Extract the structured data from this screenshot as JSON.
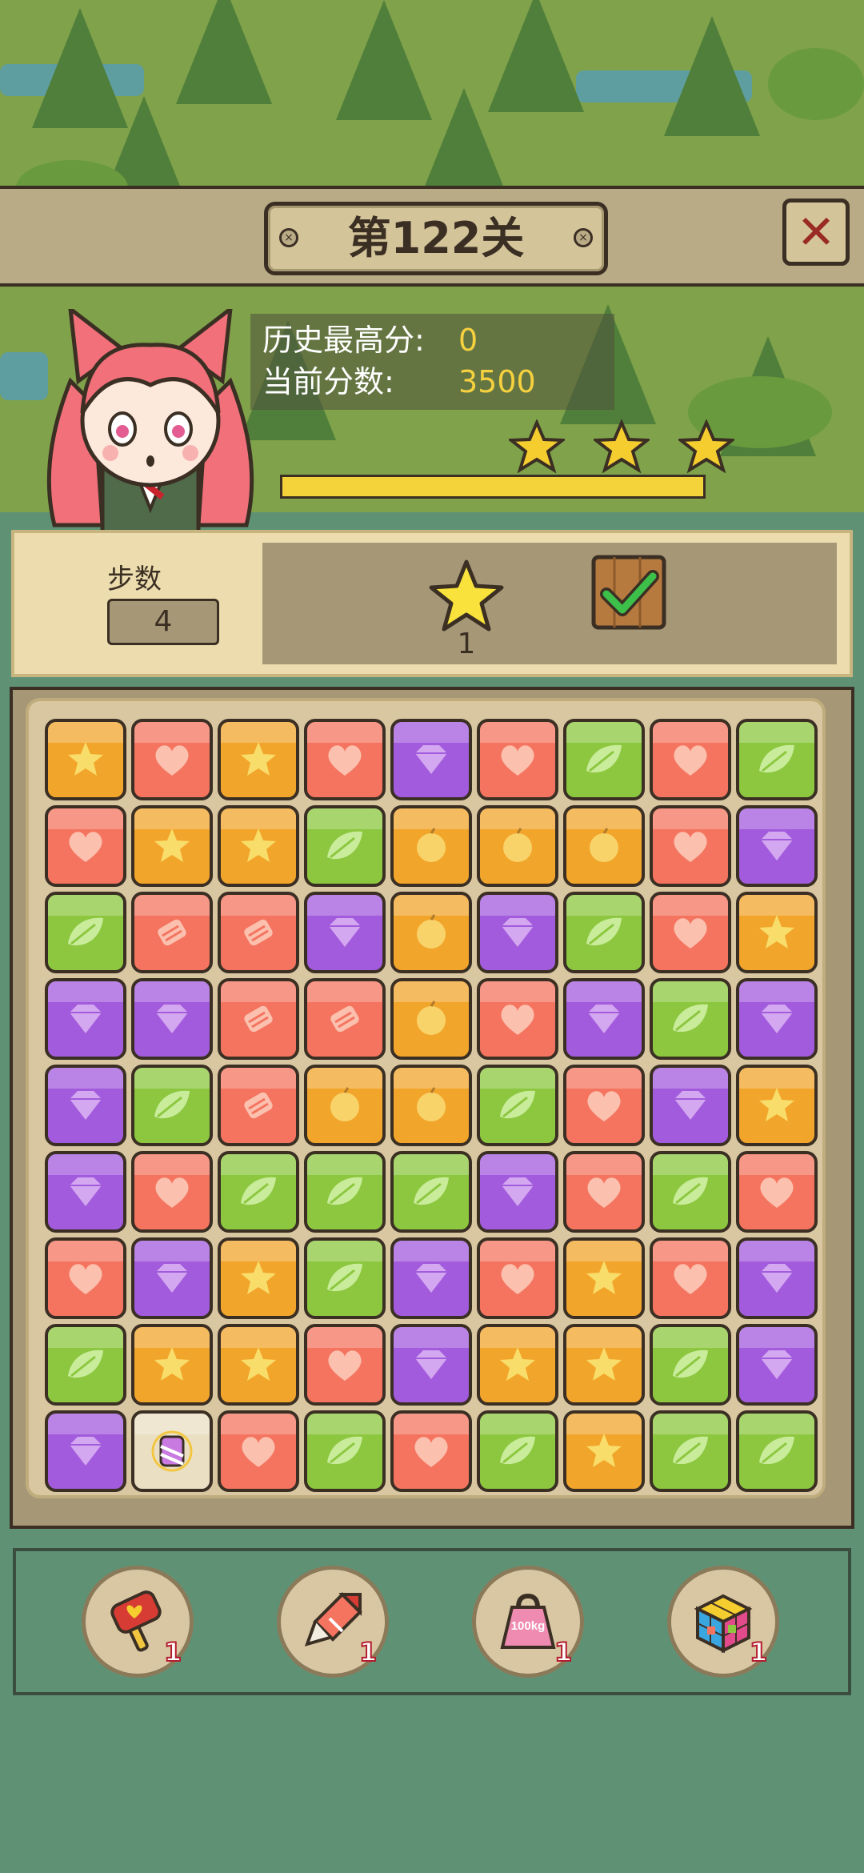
{
  "level": {
    "title": "第122关"
  },
  "close": {
    "label": "✕"
  },
  "score": {
    "best_label": "历史最高分:",
    "best_value": "0",
    "current_label": "当前分数:",
    "current_value": "3500",
    "progress_fraction": 1.0,
    "stars": 3
  },
  "moves": {
    "label": "步数",
    "value": "4"
  },
  "target": {
    "count": "1",
    "icon": "star-icon",
    "complete_icon": "checkmark-icon"
  },
  "board": {
    "rows": [
      [
        "star",
        "heart",
        "star",
        "heart",
        "gem",
        "heart",
        "leaf",
        "heart",
        "leaf"
      ],
      [
        "heart",
        "star",
        "star",
        "leaf",
        "fruit",
        "fruit",
        "fruit",
        "heart",
        "gem"
      ],
      [
        "leaf",
        "candy",
        "candy",
        "gem",
        "fruit",
        "gem",
        "leaf",
        "heart",
        "star"
      ],
      [
        "gem",
        "gem",
        "candy",
        "candy",
        "fruit",
        "heart",
        "gem",
        "leaf",
        "gem"
      ],
      [
        "gem",
        "leaf",
        "candy",
        "fruit",
        "fruit",
        "leaf",
        "heart",
        "gem",
        "star"
      ],
      [
        "gem",
        "heart",
        "leaf",
        "leaf",
        "leaf",
        "gem",
        "heart",
        "leaf",
        "heart"
      ],
      [
        "heart",
        "gem",
        "star",
        "leaf",
        "gem",
        "heart",
        "star",
        "heart",
        "gem"
      ],
      [
        "leaf",
        "star",
        "star",
        "heart",
        "gem",
        "star",
        "star",
        "leaf",
        "gem"
      ],
      [
        "gem",
        "special",
        "heart",
        "leaf",
        "heart",
        "leaf",
        "star",
        "leaf",
        "leaf"
      ]
    ]
  },
  "boosters": [
    {
      "icon": "hammer-icon",
      "count": "1"
    },
    {
      "icon": "rocket-icon",
      "count": "1"
    },
    {
      "icon": "weight-icon",
      "count": "1",
      "text": "100kg"
    },
    {
      "icon": "rainbow-cube-icon",
      "count": "1"
    }
  ],
  "colors": {
    "star": "#f2a52b",
    "heart": "#f4745f",
    "leaf": "#8cc73f",
    "gem": "#a25bdc",
    "accent": "#f4d23a"
  }
}
